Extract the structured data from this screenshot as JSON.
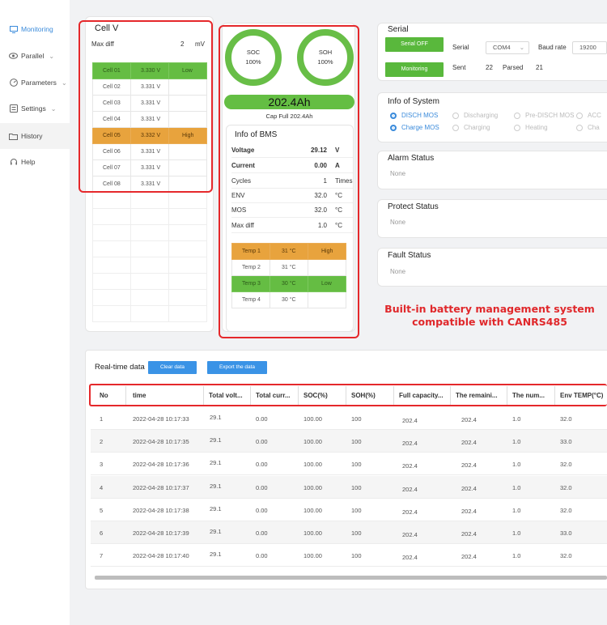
{
  "sidebar": {
    "items": [
      {
        "label": "Monitoring",
        "icon": "monitor-icon",
        "chevron": false
      },
      {
        "label": "Parallel",
        "icon": "eye-icon",
        "chevron": true
      },
      {
        "label": "Parameters",
        "icon": "gauge-icon",
        "chevron": true
      },
      {
        "label": "Settings",
        "icon": "settings-icon",
        "chevron": true
      },
      {
        "label": "History",
        "icon": "folder-icon",
        "chevron": false
      },
      {
        "label": "Help",
        "icon": "headset-icon",
        "chevron": false
      }
    ]
  },
  "cellv": {
    "title": "Cell V",
    "maxdiff_label": "Max diff",
    "maxdiff_value": "2",
    "maxdiff_unit": "mV",
    "cells": [
      {
        "name": "Cell 01",
        "value": "3.330 V",
        "status": "Low",
        "color": "green"
      },
      {
        "name": "Cell 02",
        "value": "3.331 V",
        "status": "",
        "color": ""
      },
      {
        "name": "Cell 03",
        "value": "3.331 V",
        "status": "",
        "color": ""
      },
      {
        "name": "Cell 04",
        "value": "3.331 V",
        "status": "",
        "color": ""
      },
      {
        "name": "Cell 05",
        "value": "3.332 V",
        "status": "High",
        "color": "orange"
      },
      {
        "name": "Cell 06",
        "value": "3.331 V",
        "status": "",
        "color": ""
      },
      {
        "name": "Cell 07",
        "value": "3.331 V",
        "status": "",
        "color": ""
      },
      {
        "name": "Cell 08",
        "value": "3.331 V",
        "status": "",
        "color": ""
      }
    ]
  },
  "gauges": {
    "soc_label": "SOC",
    "soc_value": "100%",
    "soh_label": "SOH",
    "soh_value": "100%"
  },
  "capacity": {
    "value": "202.4Ah",
    "full_label": "Cap Full",
    "full_value": "202.4Ah"
  },
  "bms": {
    "title": "Info of BMS",
    "rows": [
      {
        "label": "Voltage",
        "value": "29.12",
        "unit": "V",
        "bold": true
      },
      {
        "label": "Current",
        "value": "0.00",
        "unit": "A",
        "bold": true
      },
      {
        "label": "Cycles",
        "value": "1",
        "unit": "Times",
        "bold": false
      },
      {
        "label": "ENV",
        "value": "32.0",
        "unit": "°C",
        "bold": false
      },
      {
        "label": "MOS",
        "value": "32.0",
        "unit": "°C",
        "bold": false
      },
      {
        "label": "Max diff",
        "value": "1.0",
        "unit": "°C",
        "bold": false
      }
    ],
    "temps": [
      {
        "name": "Temp 1",
        "value": "31 °C",
        "status": "High",
        "color": "orange"
      },
      {
        "name": "Temp 2",
        "value": "31 °C",
        "status": "",
        "color": ""
      },
      {
        "name": "Temp 3",
        "value": "30 °C",
        "status": "Low",
        "color": "green"
      },
      {
        "name": "Temp 4",
        "value": "30 °C",
        "status": "",
        "color": ""
      }
    ]
  },
  "serial": {
    "title": "Serial",
    "serial_off_btn": "Serial OFF",
    "monitoring_btn": "Monitoring",
    "serial_label": "Serial",
    "serial_port": "COM4",
    "baud_label": "Baud rate",
    "baud_value": "19200",
    "sent_label": "Sent",
    "sent_value": "22",
    "parsed_label": "Parsed",
    "parsed_value": "21"
  },
  "system": {
    "title": "Info of System",
    "row1": [
      {
        "label": "DISCH MOS",
        "on": true
      },
      {
        "label": "Discharging",
        "on": false
      },
      {
        "label": "Pre-DISCH MOS",
        "on": false
      },
      {
        "label": "ACC",
        "on": false
      }
    ],
    "row2": [
      {
        "label": "Charge MOS",
        "on": true
      },
      {
        "label": "Charging",
        "on": false
      },
      {
        "label": "Heating",
        "on": false
      },
      {
        "label": "Cha",
        "on": false
      }
    ]
  },
  "alarm": {
    "title": "Alarm Status",
    "value": "None"
  },
  "protect": {
    "title": "Protect Status",
    "value": "None"
  },
  "fault": {
    "title": "Fault Status",
    "value": "None"
  },
  "promo": {
    "line1": "Built-in battery management system",
    "line2": "compatible with CANRS485"
  },
  "realtime": {
    "title": "Real-time data",
    "clear_btn": "Clear data",
    "export_btn": "Export the data",
    "columns": [
      "No",
      "time",
      "Total volt...",
      "Total curr...",
      "SOC(%)",
      "SOH(%)",
      "Full capacity...",
      "The remaini...",
      "The num...",
      "Env TEMP(°C)"
    ],
    "rows": [
      [
        "1",
        "2022-04-28 10:17:33",
        "29.1",
        "0.00",
        "100.00",
        "100",
        "202.4",
        "202.4",
        "1.0",
        "32.0"
      ],
      [
        "2",
        "2022-04-28 10:17:35",
        "29.1",
        "0.00",
        "100.00",
        "100",
        "202.4",
        "202.4",
        "1.0",
        "33.0"
      ],
      [
        "3",
        "2022-04-28 10:17:36",
        "29.1",
        "0.00",
        "100.00",
        "100",
        "202.4",
        "202.4",
        "1.0",
        "32.0"
      ],
      [
        "4",
        "2022-04-28 10:17:37",
        "29.1",
        "0.00",
        "100.00",
        "100",
        "202.4",
        "202.4",
        "1.0",
        "32.0"
      ],
      [
        "5",
        "2022-04-28 10:17:38",
        "29.1",
        "0.00",
        "100.00",
        "100",
        "202.4",
        "202.4",
        "1.0",
        "32.0"
      ],
      [
        "6",
        "2022-04-28 10:17:39",
        "29.1",
        "0.00",
        "100.00",
        "100",
        "202.4",
        "202.4",
        "1.0",
        "33.0"
      ],
      [
        "7",
        "2022-04-28 10:17:40",
        "29.1",
        "0.00",
        "100.00",
        "100",
        "202.4",
        "202.4",
        "1.0",
        "32.0"
      ]
    ]
  },
  "colors": {
    "accent_green": "#65bd43",
    "accent_orange": "#e8a33d",
    "accent_blue": "#3a93e6",
    "highlight_red": "#e5282b"
  }
}
